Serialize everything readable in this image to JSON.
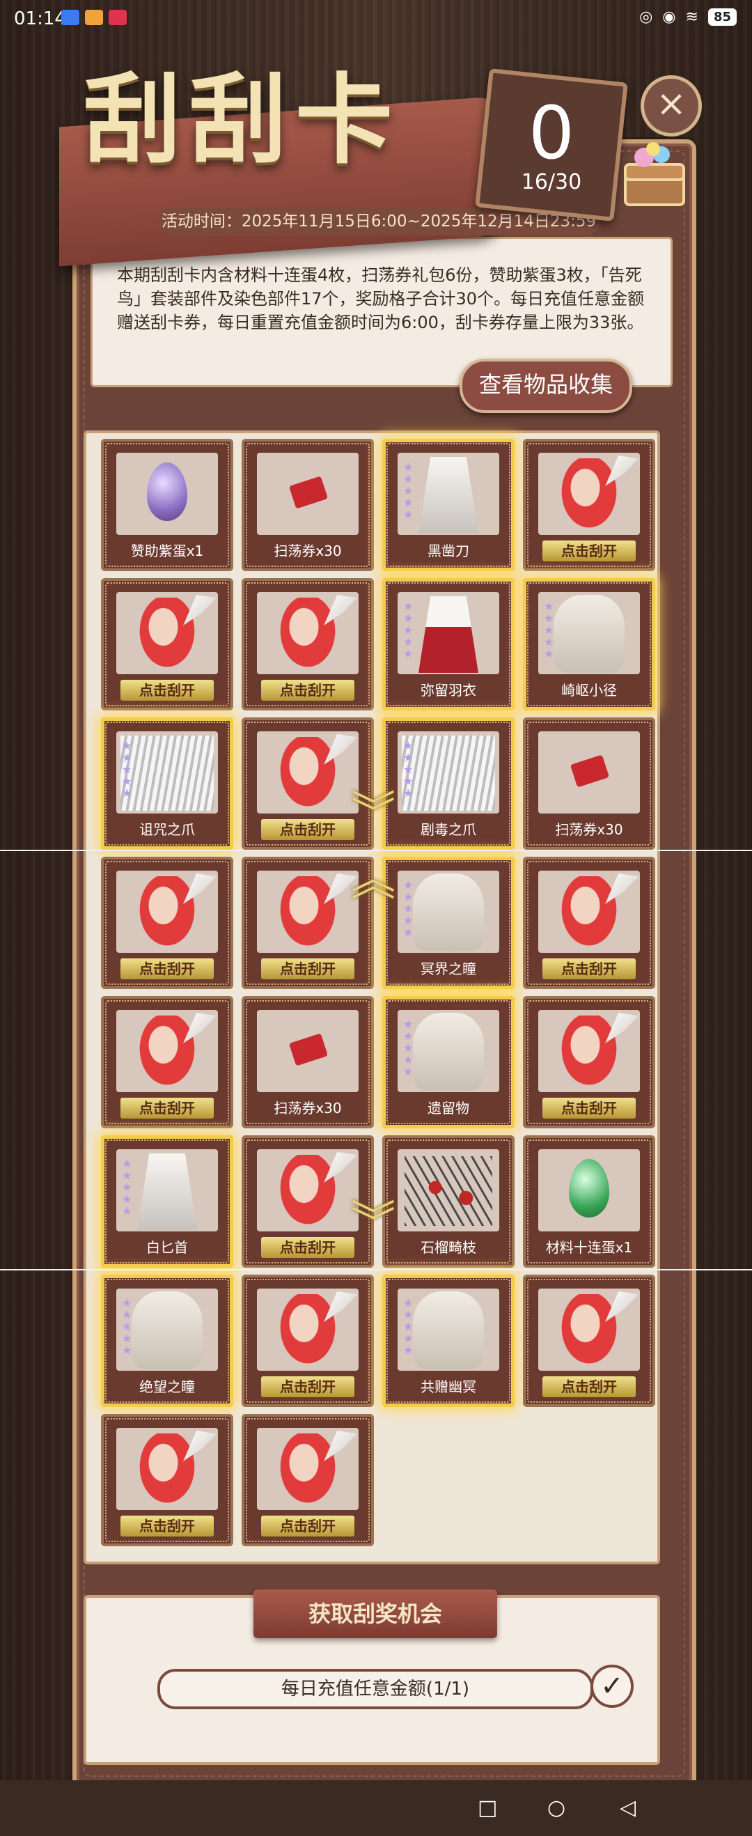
{
  "status": {
    "time": "01:14",
    "battery": "85"
  },
  "header": {
    "title": "刮刮卡",
    "counter_value": "0",
    "counter_total": "16/30",
    "close_symbol": "×",
    "date": "活动时间：2025年11月15日6:00~2025年12月14日23:59",
    "description": "本期刮刮卡内含材料十连蛋4枚，扫荡券礼包6份，赞助紫蛋3枚，「告死鸟」套装部件及染色部件17个，奖励格子合计30个。每日充值任意金额赠送刮卡券，每日重置充值金额时间为6:00，刮卡券存量上限为33张。",
    "collect_button": "查看物品收集"
  },
  "cards": [
    {
      "label": "赞助紫蛋x1",
      "type": "egg-purple",
      "scratched": true,
      "gold": false
    },
    {
      "label": "扫荡券x30",
      "type": "ticket",
      "scratched": true,
      "gold": false
    },
    {
      "label": "黑凿刀",
      "type": "cloth-white",
      "scratched": true,
      "gold": true
    },
    {
      "label": "点击刮开",
      "type": "hidden",
      "scratched": false,
      "gold": false
    },
    {
      "label": "点击刮开",
      "type": "hidden",
      "scratched": false,
      "gold": false
    },
    {
      "label": "点击刮开",
      "type": "hidden",
      "scratched": false,
      "gold": false
    },
    {
      "label": "弥留羽衣",
      "type": "cloth-red",
      "scratched": true,
      "gold": true
    },
    {
      "label": "崎岖小径",
      "type": "hair-white",
      "scratched": true,
      "gold": true
    },
    {
      "label": "诅咒之爪",
      "type": "fur",
      "scratched": true,
      "gold": true
    },
    {
      "label": "点击刮开",
      "type": "hidden",
      "scratched": false,
      "gold": false
    },
    {
      "label": "剧毒之爪",
      "type": "fur",
      "scratched": true,
      "gold": true
    },
    {
      "label": "扫荡券x30",
      "type": "ticket",
      "scratched": true,
      "gold": false
    },
    {
      "label": "点击刮开",
      "type": "hidden",
      "scratched": false,
      "gold": false
    },
    {
      "label": "点击刮开",
      "type": "hidden",
      "scratched": false,
      "gold": false
    },
    {
      "label": "冥界之瞳",
      "type": "hair-white",
      "scratched": true,
      "gold": true
    },
    {
      "label": "点击刮开",
      "type": "hidden",
      "scratched": false,
      "gold": false
    },
    {
      "label": "点击刮开",
      "type": "hidden",
      "scratched": false,
      "gold": false
    },
    {
      "label": "扫荡券x30",
      "type": "ticket",
      "scratched": true,
      "gold": false
    },
    {
      "label": "遗留物",
      "type": "hair-white",
      "scratched": true,
      "gold": true
    },
    {
      "label": "点击刮开",
      "type": "hidden",
      "scratched": false,
      "gold": false
    },
    {
      "label": "白匕首",
      "type": "cloth-white",
      "scratched": true,
      "gold": true
    },
    {
      "label": "点击刮开",
      "type": "hidden",
      "scratched": false,
      "gold": false
    },
    {
      "label": "石榴畸枝",
      "type": "branch",
      "scratched": true,
      "gold": false
    },
    {
      "label": "材料十连蛋x1",
      "type": "egg-green",
      "scratched": true,
      "gold": false
    },
    {
      "label": "绝望之瞳",
      "type": "hair-white",
      "scratched": true,
      "gold": true
    },
    {
      "label": "点击刮开",
      "type": "hidden",
      "scratched": false,
      "gold": false
    },
    {
      "label": "共赠幽冥",
      "type": "hair-white",
      "scratched": true,
      "gold": true
    },
    {
      "label": "点击刮开",
      "type": "hidden",
      "scratched": false,
      "gold": false
    },
    {
      "label": "点击刮开",
      "type": "hidden",
      "scratched": false,
      "gold": false
    },
    {
      "label": "点击刮开",
      "type": "hidden",
      "scratched": false,
      "gold": false
    }
  ],
  "bottom": {
    "banner": "获取刮奖机会",
    "task": "每日充值任意金额(1/1)",
    "task_check": "✓"
  },
  "colors": {
    "gold_glow": "#f3cd4a",
    "panel": "#6b4338",
    "accent_red": "#c9282e"
  }
}
